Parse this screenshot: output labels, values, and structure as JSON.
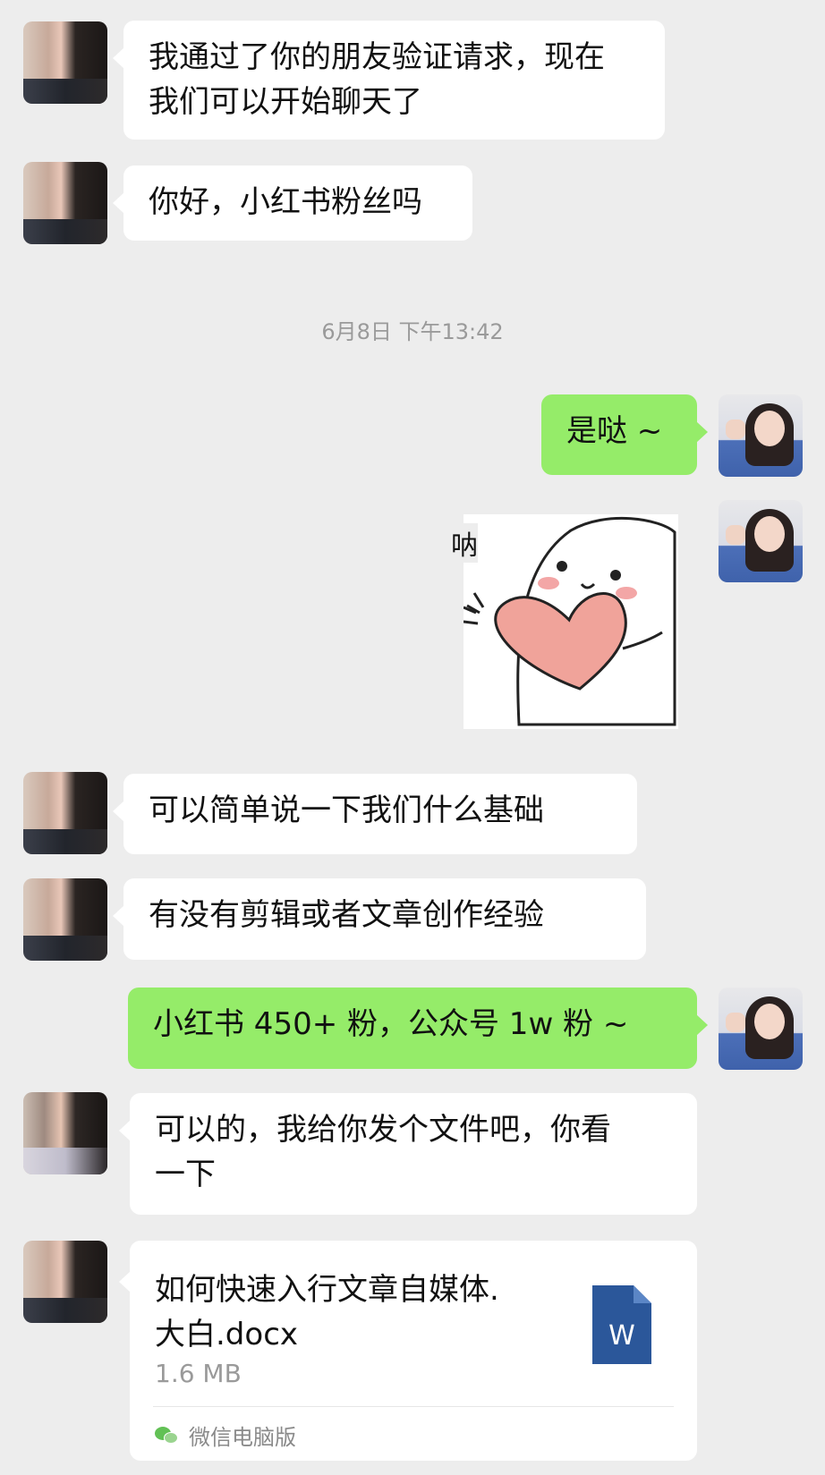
{
  "messages": [
    {
      "id": "m1",
      "side": "in",
      "text_line1": "我通过了你的朋友验证请求，现在",
      "text_line2": "我们可以开始聊天了"
    },
    {
      "id": "m2",
      "side": "in",
      "text": "你好，小红书粉丝吗"
    },
    {
      "id": "m3",
      "side": "out",
      "text": "是哒 ~"
    },
    {
      "id": "m4",
      "side": "out",
      "sticker_caption": "呐"
    },
    {
      "id": "m5",
      "side": "in",
      "text": "可以简单说一下我们什么基础"
    },
    {
      "id": "m6",
      "side": "in",
      "text": "有没有剪辑或者文章创作经验"
    },
    {
      "id": "m7",
      "side": "out",
      "text": "小红书 450+ 粉，公众号 1w 粉 ~"
    },
    {
      "id": "m8",
      "side": "in",
      "text_line1": "可以的，我给你发个文件吧，你看",
      "text_line2": "一下"
    }
  ],
  "timestamp": "6月8日 下午13:42",
  "file": {
    "name_line1": "如何快速入行文章自媒体.",
    "name_line2": "大白.docx",
    "size": "1.6 MB",
    "icon_letter": "W",
    "source": "微信电脑版"
  },
  "colors": {
    "background": "#ededed",
    "incoming_bubble": "#ffffff",
    "outgoing_bubble": "#95ec69",
    "word_icon": "#2b579a"
  },
  "icons": [
    "doc-icon",
    "wechat-icon"
  ]
}
